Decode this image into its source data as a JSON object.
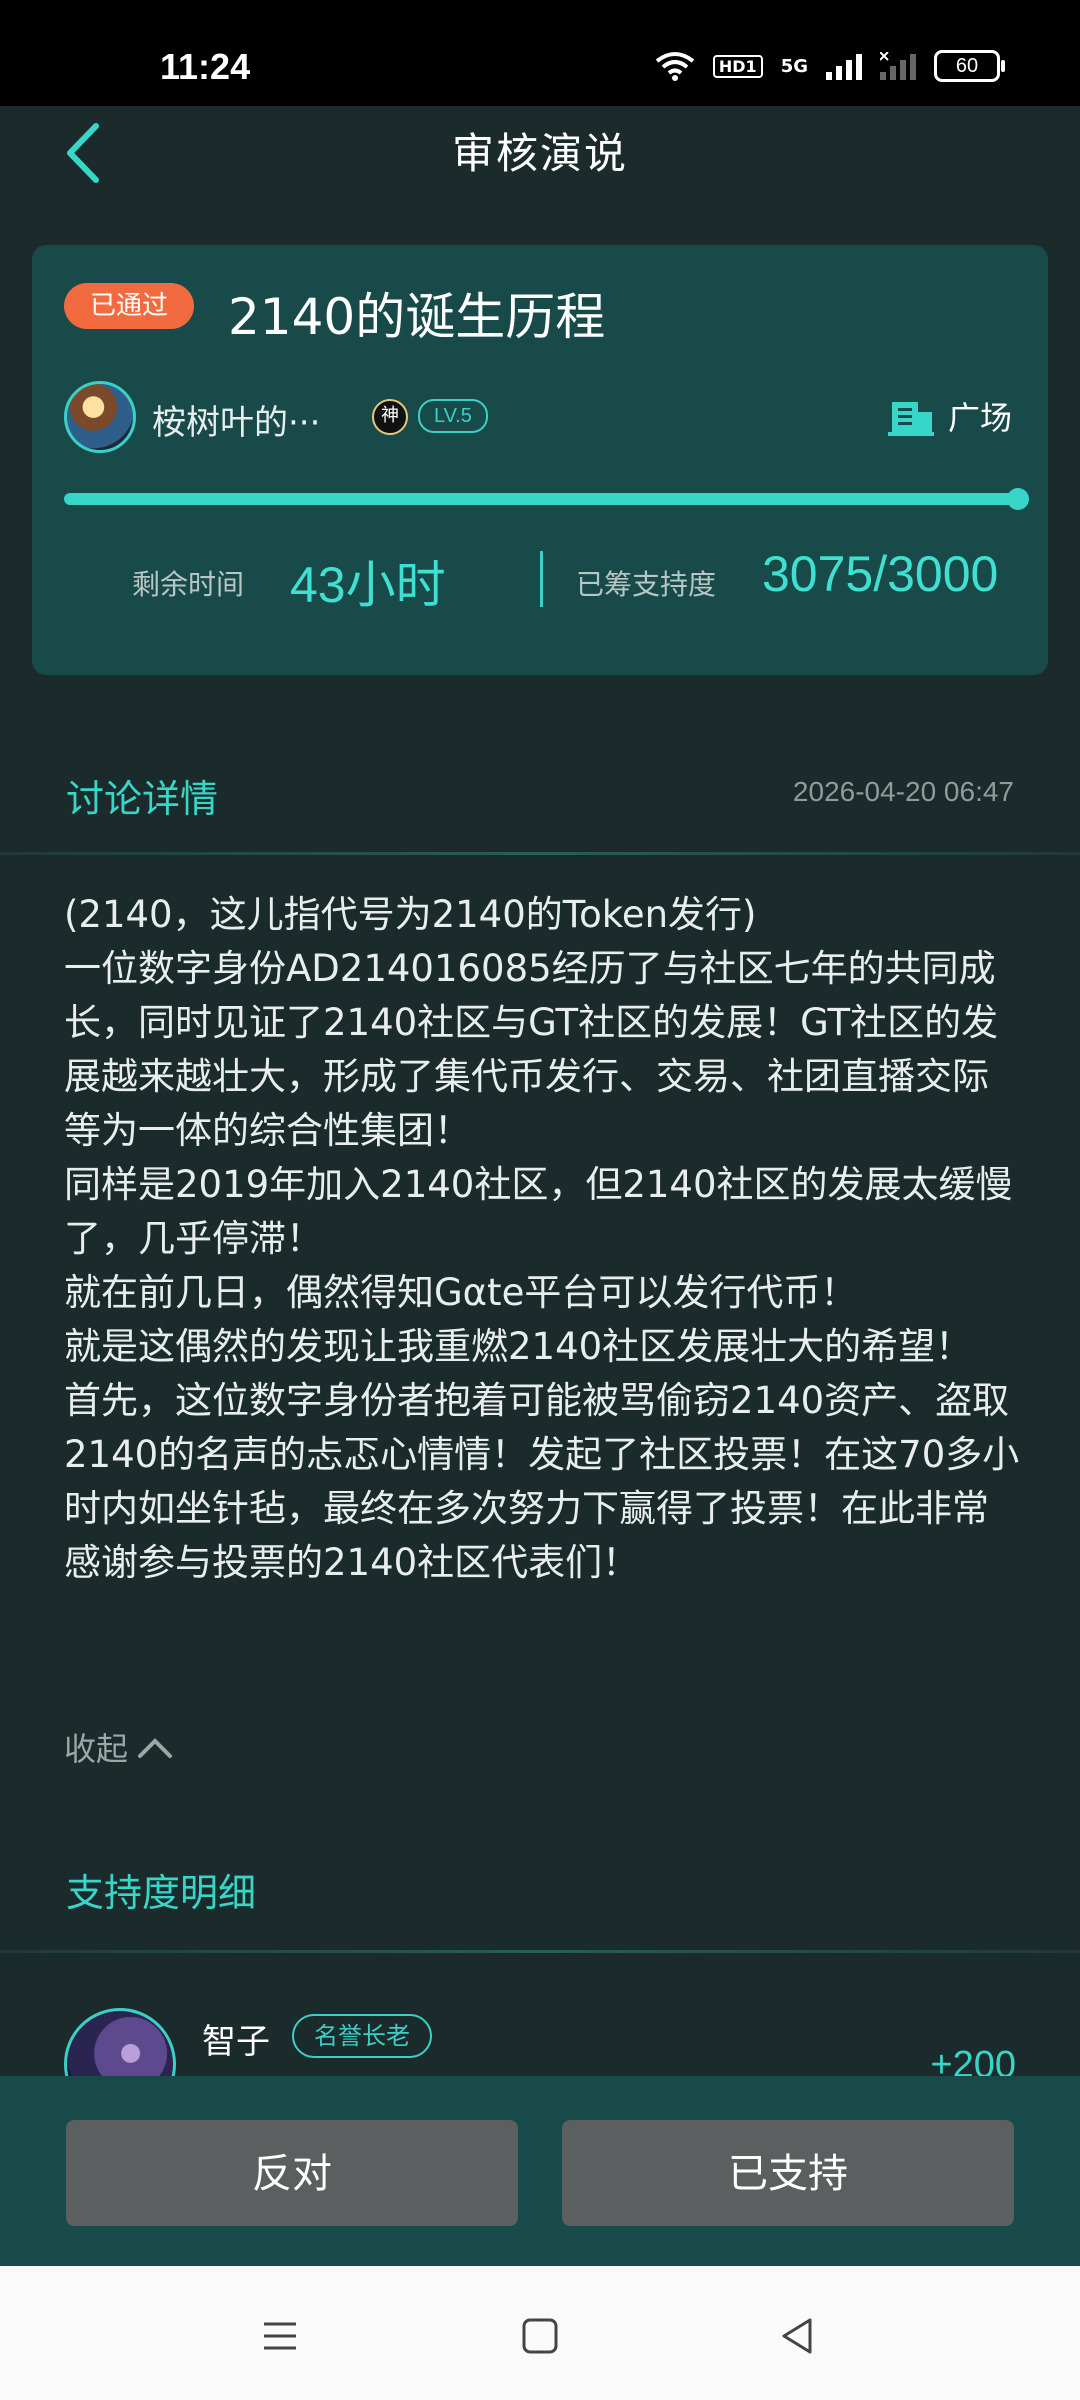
{
  "status_bar": {
    "time": "11:24",
    "hd": "HD1",
    "network": "5G",
    "battery": "60"
  },
  "header": {
    "title": "审核演说"
  },
  "card": {
    "status_badge": "已通过",
    "title": "2140的诞生历程",
    "author_name": "桉树叶的···",
    "god_badge": "神",
    "level": "LV.5",
    "square_label": "广场",
    "progress_fraction": 1.0,
    "remaining_label": "剩余时间",
    "remaining_value": "43小时",
    "support_label": "已筹支持度",
    "support_value": "3075/3000"
  },
  "discussion": {
    "title": "讨论详情",
    "date": "2026-04-20 06:47",
    "content": "(2140，这儿指代号为2140的Token发行)\n一位数字身份AD214016085经历了与社区七年的共同成长，同时见证了2140社区与GT社区的发展！GT社区的发展越来越壮大，形成了集代币发行、交易、社团直播交际等为一体的综合性集团！\n同样是2019年加入2140社区，但2140社区的发展太缓慢了，几乎停滞！\n就在前几日，偶然得知Gαte平台可以发行代币！\n就是这偶然的发现让我重燃2140社区发展壮大的希望！\n首先，这位数字身份者抱着可能被骂偷窃2140资产、盗取2140的名声的忐忑心情情！发起了社区投票！在这70多小时内如坐针毡，最终在多次努力下赢得了投票！在此非常感谢参与投票的2140社区代表们！",
    "collapse_label": "收起"
  },
  "support_detail": {
    "title": "支持度明细",
    "items": [
      {
        "name": "智子",
        "badge": "名誉长老",
        "points": "+200"
      }
    ]
  },
  "actions": {
    "oppose_label": "反对",
    "support_label": "已支持"
  },
  "colors": {
    "accent": "#38d6c8",
    "card_bg": "#174a49",
    "badge_orange": "#f26a3f",
    "page_bg": "#1b2a2a"
  }
}
